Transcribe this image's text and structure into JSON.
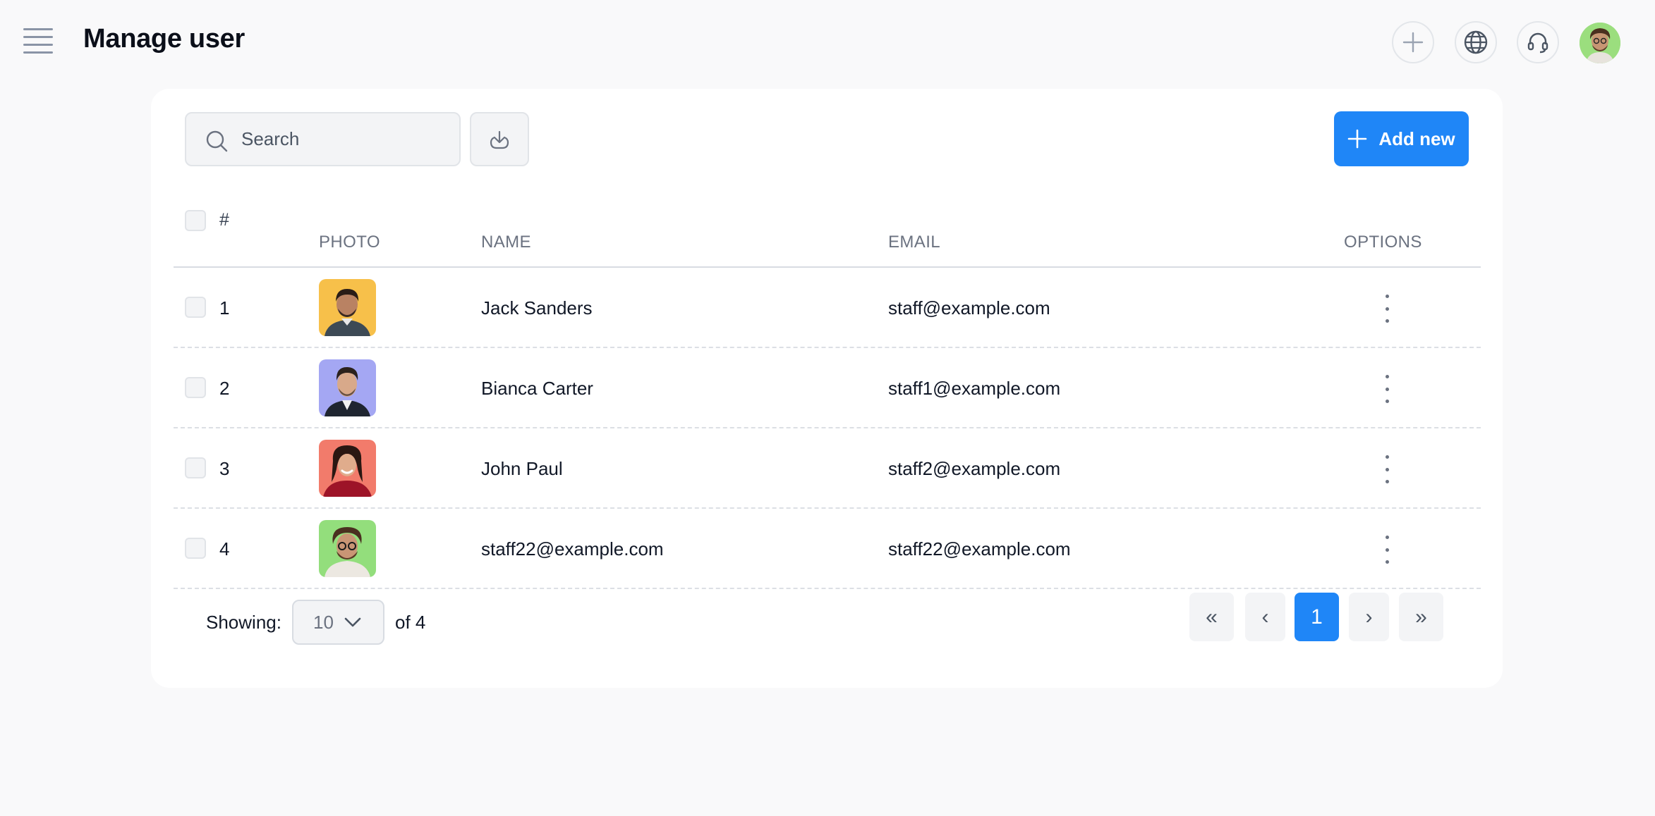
{
  "header": {
    "title": "Manage user",
    "icons": [
      "menu-icon",
      "plus-icon",
      "globe-icon",
      "headset-icon",
      "user-avatar"
    ]
  },
  "toolbar": {
    "search_placeholder": "Search",
    "add_label": "Add new"
  },
  "table": {
    "columns": {
      "index": "#",
      "photo": "PHOTO",
      "name": "NAME",
      "email": "EMAIL",
      "options": "OPTIONS"
    },
    "rows": [
      {
        "index": "1",
        "name": "Jack Sanders",
        "email": "staff@example.com",
        "photo_bg": "#f7c04a"
      },
      {
        "index": "2",
        "name": "Bianca Carter",
        "email": "staff1@example.com",
        "photo_bg": "#a4a7f3"
      },
      {
        "index": "3",
        "name": "John Paul",
        "email": "staff2@example.com",
        "photo_bg": "#f27b6b"
      },
      {
        "index": "4",
        "name": "staff22@example.com",
        "email": "staff22@example.com",
        "photo_bg": "#93de7c"
      }
    ]
  },
  "footer": {
    "showing_label": "Showing:",
    "per_page": "10",
    "of_total": "of 4",
    "pagination": {
      "first": "«",
      "prev": "‹",
      "current": "1",
      "next": "›",
      "last": "»"
    }
  },
  "colors": {
    "accent": "#1f86f7",
    "background": "#f9f9fa",
    "card": "#ffffff"
  }
}
